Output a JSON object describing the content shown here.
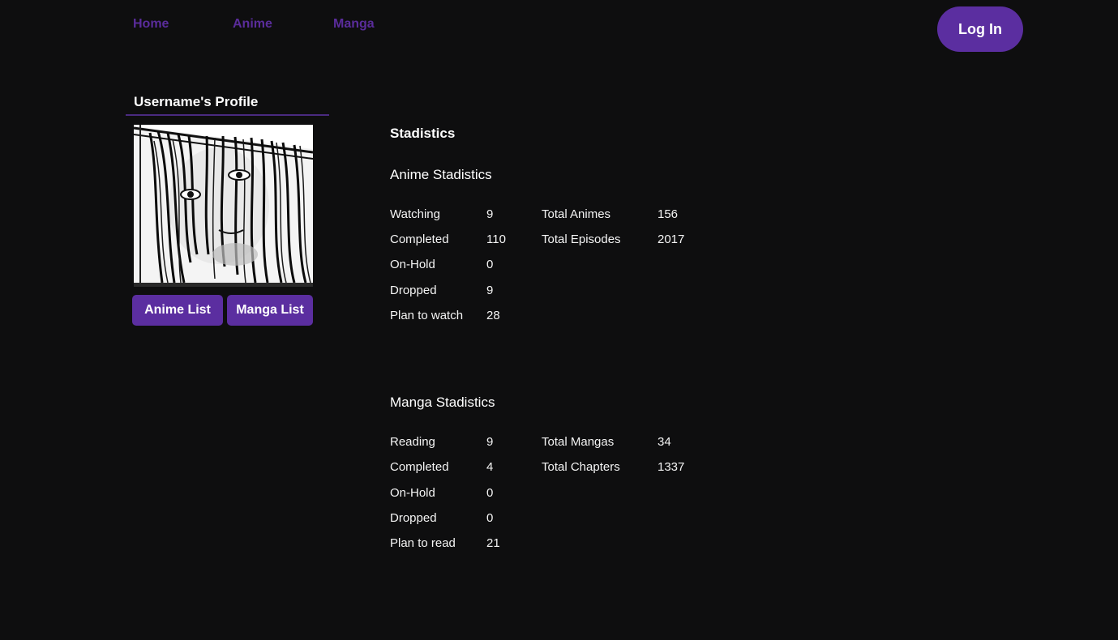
{
  "nav": {
    "home": "Home",
    "anime": "Anime",
    "manga": "Manga",
    "login": "Log In"
  },
  "profile": {
    "title": "Username's Profile",
    "anime_list_btn": "Anime List",
    "manga_list_btn": "Manga List"
  },
  "stats": {
    "title": "Stadistics",
    "anime": {
      "title": "Anime Stadistics",
      "rows": [
        {
          "label": "Watching",
          "value": "9"
        },
        {
          "label": "Completed",
          "value": "110"
        },
        {
          "label": "On-Hold",
          "value": "0"
        },
        {
          "label": "Dropped",
          "value": "9"
        },
        {
          "label": "Plan to watch",
          "value": "28"
        }
      ],
      "totals": [
        {
          "label": "Total Animes",
          "value": "156"
        },
        {
          "label": "Total Episodes",
          "value": "2017"
        }
      ]
    },
    "manga": {
      "title": "Manga Stadistics",
      "rows": [
        {
          "label": "Reading",
          "value": "9"
        },
        {
          "label": "Completed",
          "value": "4"
        },
        {
          "label": "On-Hold",
          "value": "0"
        },
        {
          "label": "Dropped",
          "value": "0"
        },
        {
          "label": "Plan to read",
          "value": "21"
        }
      ],
      "totals": [
        {
          "label": "Total Mangas",
          "value": "34"
        },
        {
          "label": "Total Chapters",
          "value": "1337"
        }
      ]
    }
  },
  "colors": {
    "background": "#0e0e0f",
    "accent": "#5b2ea0",
    "nav_link": "#5a2c9b"
  }
}
